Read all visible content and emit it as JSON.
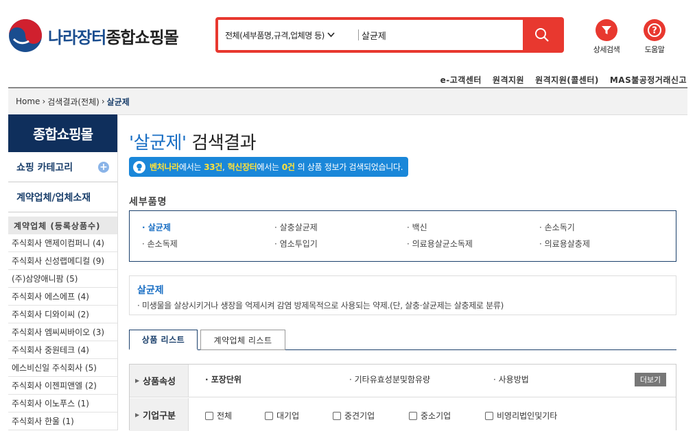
{
  "header": {
    "logo_part1": "나라장터",
    "logo_part2": "종합쇼핑몰",
    "search_scope": "전체(세부품명,규격,업체명 등)",
    "search_value": "살균제",
    "detail_search_label": "상세검색",
    "help_label": "도움말",
    "brand_color": "#e8382f"
  },
  "util_links": [
    "e-고객센터",
    "원격지원",
    "원격지원(콜센터)",
    "MAS불공정거래신고"
  ],
  "breadcrumb": {
    "home": "Home",
    "level1": "검색결과(전체)",
    "current": "살균제"
  },
  "sidebar": {
    "title": "종합쇼핑몰",
    "menu1": "쇼핑 카테고리",
    "menu2": "계약업체/업체소재",
    "vendor_header": "계약업체 (등록상품수)",
    "vendors": [
      "주식회사 앤제이컴퍼니 (4)",
      "주식회사 신성랩메디컬 (9)",
      "(주)삼양애니팜 (5)",
      "주식회사 에스에프 (4)",
      "주식회사 디와이씨 (2)",
      "주식회사 엠씨씨바이오 (3)",
      "주식회사 중원테크 (4)",
      "에스비신일 주식회사 (5)",
      "주식회사 이젠피앤엘 (2)",
      "주식회사 이노푸스 (1)",
      "주식회사 한울 (1)"
    ]
  },
  "result": {
    "keyword": "'살균제'",
    "title_suffix": "검색결과",
    "note_site1": "벤처나라",
    "note_mid1": "에서는",
    "note_count1": "33건",
    "note_sep": ",",
    "note_site2": "혁신장터",
    "note_mid2": "에서는",
    "note_count2": "0건",
    "note_tail": "의 상품 정보가 검색되었습니다."
  },
  "sub_items_header": "세부품명",
  "sub_items": [
    "살균제",
    "살충살균제",
    "백신",
    "손소독기",
    "손소독제",
    "염소투입기",
    "의료용살균소독제",
    "의료용살충제"
  ],
  "definition": {
    "term": "살균제",
    "text": "미생물을 살상시키거나 생장을 억제시켜 감염 방제목적으로 사용되는 약제.(단, 살충·살균제는 살충제로 분류)"
  },
  "tabs": [
    "상품 리스트",
    "계약업체 리스트"
  ],
  "filters": {
    "attr_label": "상품속성",
    "attrs": [
      "포장단위",
      "기타유효성분및함유량",
      "사용방법"
    ],
    "more_label": "더보기",
    "company_label": "기업구분",
    "company_types": [
      "전체",
      "대기업",
      "중견기업",
      "중소기업",
      "비영리법인및기타"
    ]
  }
}
